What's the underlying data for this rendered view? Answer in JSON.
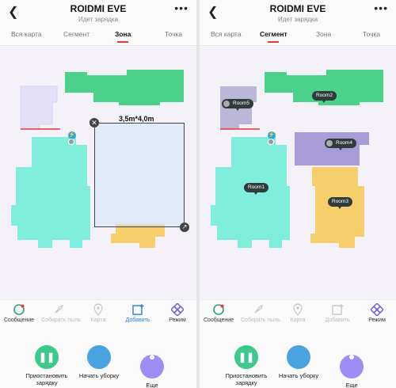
{
  "colors": {
    "active_tab_underline": "#e53935",
    "green_room": "#4bd18a",
    "cyan_room": "#7feedd",
    "purple_room": "#b9aee6",
    "yellow_room": "#f6cf6b",
    "zone_fill": "#cfe2f6",
    "pause_button": "#3cc98c",
    "start_button": "#4aa3e0",
    "more_button": "#9c8ef5"
  },
  "left": {
    "header": {
      "title": "ROIDMI EVE",
      "subtitle": "Идет зарядка",
      "back_icon": "chevron-left-icon",
      "menu_icon": "more-dots-icon"
    },
    "tabs": [
      {
        "label": "Вся карта",
        "active": false
      },
      {
        "label": "Сегмент",
        "active": false
      },
      {
        "label": "Зона",
        "active": true
      },
      {
        "label": "Точка",
        "active": false
      }
    ],
    "map": {
      "zone_label": "3,5m*4,0m"
    },
    "toolbar": [
      {
        "label": "Сообщение",
        "icon": "message-icon",
        "enabled": true
      },
      {
        "label": "Собирать пыль",
        "icon": "rocket-icon",
        "enabled": false
      },
      {
        "label": "Карта",
        "icon": "map-pin-icon",
        "enabled": false
      },
      {
        "label": "Добавить",
        "icon": "add-zone-icon",
        "enabled": true
      },
      {
        "label": "Режим",
        "icon": "mode-icon",
        "enabled": true
      }
    ],
    "actions": [
      {
        "label": "Приостановить зарядку",
        "icon": "pause-icon"
      },
      {
        "label": "Начать уборку",
        "icon": "broom-icon"
      },
      {
        "label": "Еще",
        "icon": "dot-icon"
      }
    ]
  },
  "right": {
    "header": {
      "title": "ROIDMI EVE",
      "subtitle": "Идет зарядка",
      "back_icon": "chevron-left-icon",
      "menu_icon": "more-dots-icon"
    },
    "tabs": [
      {
        "label": "Вся карта",
        "active": false
      },
      {
        "label": "Сегмент",
        "active": true
      },
      {
        "label": "Зона",
        "active": false
      },
      {
        "label": "Точка",
        "active": false
      }
    ],
    "rooms": [
      {
        "name": "Room5",
        "selected": true
      },
      {
        "name": "Room2",
        "selected": false
      },
      {
        "name": "Room4",
        "selected": true
      },
      {
        "name": "Room1",
        "selected": false
      },
      {
        "name": "Room3",
        "selected": false
      }
    ],
    "toolbar": [
      {
        "label": "Сообщение",
        "icon": "message-icon",
        "enabled": true
      },
      {
        "label": "Собирать пыль",
        "icon": "rocket-icon",
        "enabled": false
      },
      {
        "label": "Карта",
        "icon": "map-pin-icon",
        "enabled": false
      },
      {
        "label": "Добавить",
        "icon": "add-zone-icon",
        "enabled": false
      },
      {
        "label": "Режим",
        "icon": "mode-icon",
        "enabled": true
      }
    ],
    "actions": [
      {
        "label": "Приостановить зарядку",
        "icon": "pause-icon"
      },
      {
        "label": "Начать уборку",
        "icon": "broom-icon"
      },
      {
        "label": "Еще",
        "icon": "dot-icon"
      }
    ]
  }
}
